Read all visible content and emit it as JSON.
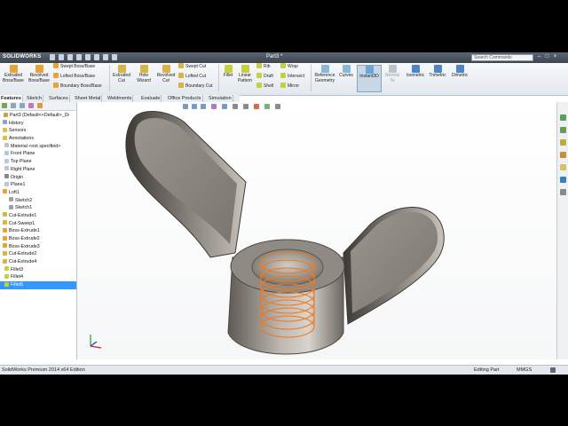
{
  "app": {
    "logo": "SOLIDWORKS",
    "doc_title": "Part3 *"
  },
  "search": {
    "placeholder": "Search Commands"
  },
  "ribbon": {
    "extruded_boss": "Extruded Boss/Base",
    "revolved_boss": "Revolved Boss/Base",
    "swept_boss": "Swept Boss/Base",
    "lofted_boss": "Lofted Boss/Base",
    "boundary_boss": "Boundary Boss/Base",
    "extruded_cut": "Extruded Cut",
    "hole_wizard": "Hole Wizard",
    "revolved_cut": "Revolved Cut",
    "swept_cut": "Swept Cut",
    "lofted_cut": "Lofted Cut",
    "boundary_cut": "Boundary Cut",
    "fillet": "Fillet",
    "linear_pattern": "Linear Pattern",
    "rib": "Rib",
    "draft": "Draft",
    "shell": "Shell",
    "wrap": "Wrap",
    "intersect": "Intersect",
    "mirror": "Mirror",
    "reference_geometry": "Reference Geometry",
    "curves": "Curves",
    "instant3d": "Instant3D",
    "normal_to": "Normal To",
    "isometric": "Isometric",
    "trimetric": "Trimetric",
    "dimetric": "Dimetric"
  },
  "tabs": [
    "Features",
    "Sketch",
    "Surfaces",
    "Sheet Metal",
    "Weldments",
    "Evaluate",
    "Office Products",
    "Simulation"
  ],
  "tree": [
    "Part3  (Default<<Default>_Di",
    "History",
    "Sensors",
    "Annotations",
    "Material <not specified>",
    "Front Plane",
    "Top Plane",
    "Right Plane",
    "Origin",
    "Plane1",
    "Loft1",
    "Sketch2",
    "Sketch1",
    "Cut-Extrude1",
    "Cut-Sweep1",
    "Boss-Extrude1",
    "Boss-Extrude2",
    "Boss-Extrude3",
    "Cut-Extrude2",
    "Cut-Extrude4",
    "Fillet3",
    "Fillet4",
    "Fillet5"
  ],
  "status": {
    "edition": "SolidWorks Premium 2014 x64 Edition",
    "mode": "Editing Part",
    "units": "MMGS"
  },
  "colors": {
    "thread": "#f07820",
    "selection": "#3399ff"
  }
}
